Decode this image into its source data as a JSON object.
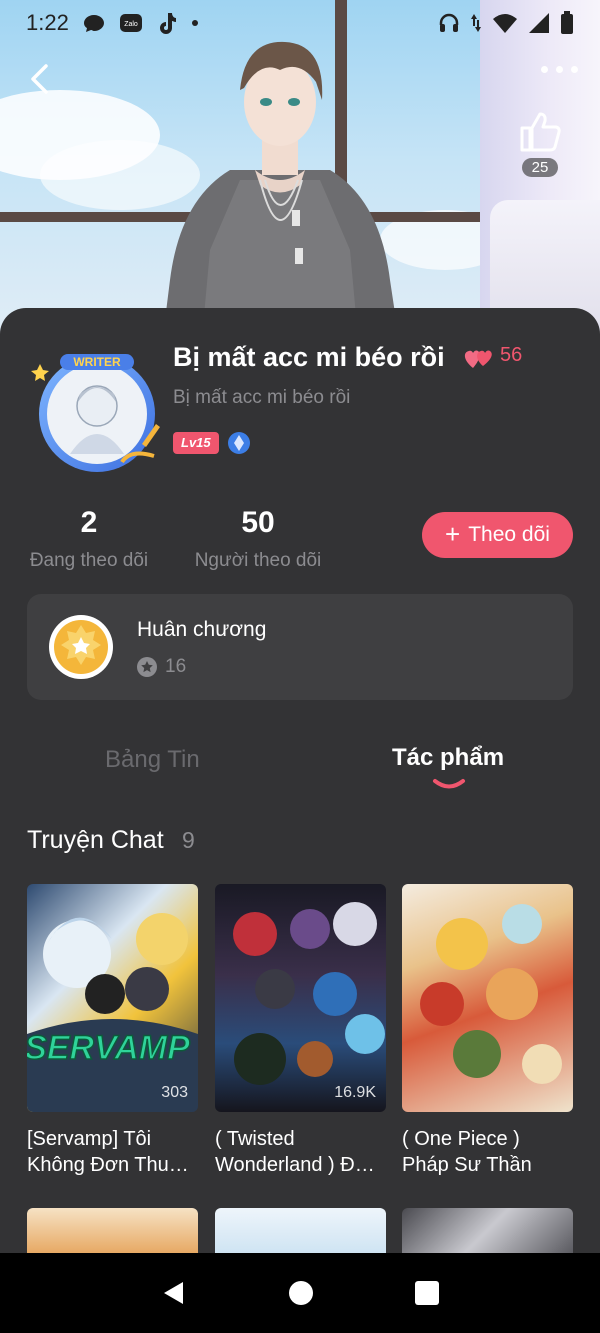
{
  "status_bar": {
    "time": "1:22",
    "app_icons": [
      "chat-bubble-icon",
      "zalo-icon",
      "tiktok-icon",
      "dot-icon"
    ],
    "system_icons": [
      "headset-icon",
      "data-arrows-icon",
      "wifi-icon",
      "signal-icon",
      "battery-icon"
    ],
    "zalo_label": "Zalo"
  },
  "header": {
    "like_count": "25"
  },
  "profile": {
    "avatar_badge": "WRITER",
    "name": "Bị mất acc mi béo rồi",
    "heart_count": "56",
    "subtitle": "Bị mất acc mi béo rồi",
    "level": "Lv15"
  },
  "stats": {
    "following_count": "2",
    "following_label": "Đang theo dõi",
    "followers_count": "50",
    "followers_label": "Người theo dõi"
  },
  "follow_button": {
    "plus": "+",
    "label": "Theo dõi"
  },
  "medal": {
    "title": "Huân chương",
    "count": "16"
  },
  "tabs": [
    {
      "label": "Bảng Tin",
      "active": false
    },
    {
      "label": "Tác phẩm",
      "active": true
    }
  ],
  "section": {
    "title": "Truyện Chat",
    "count": "9"
  },
  "books": [
    {
      "title_line1": "[Servamp] Tôi",
      "title_line2": "Không Đơn Thu…",
      "views": "303",
      "cover_text": "SERVAMP"
    },
    {
      "title_line1": "( Twisted",
      "title_line2": "Wonderland ) Đ…",
      "views": "16.9K"
    },
    {
      "title_line1": "( One Piece )",
      "title_line2": "Pháp Sư Thần",
      "views": ""
    }
  ],
  "colors": {
    "accent": "#f0566e",
    "card_bg": "#333335",
    "muted_text": "#8c8c90"
  }
}
